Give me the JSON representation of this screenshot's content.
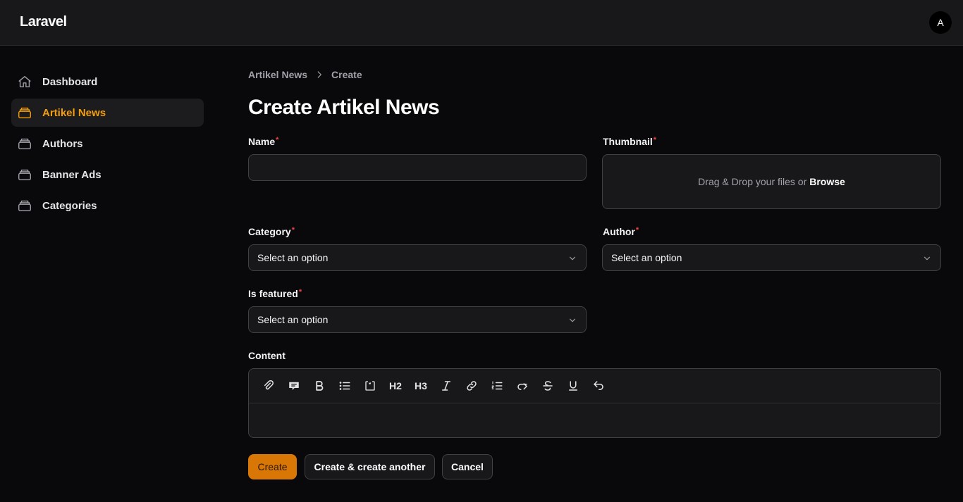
{
  "app": {
    "brand": "Laravel",
    "avatar_initial": "A"
  },
  "sidebar": {
    "items": [
      {
        "label": "Dashboard",
        "icon": "home-icon",
        "active": false
      },
      {
        "label": "Artikel News",
        "icon": "stack-icon",
        "active": true
      },
      {
        "label": "Authors",
        "icon": "stack-icon",
        "active": false
      },
      {
        "label": "Banner Ads",
        "icon": "stack-icon",
        "active": false
      },
      {
        "label": "Categories",
        "icon": "stack-icon",
        "active": false
      }
    ]
  },
  "breadcrumb": {
    "parent": "Artikel News",
    "current": "Create",
    "separator_icon": "chevron-right-icon"
  },
  "page": {
    "title": "Create Artikel News"
  },
  "form": {
    "name": {
      "label": "Name",
      "required_mark": "*",
      "value": ""
    },
    "thumbnail": {
      "label": "Thumbnail",
      "required_mark": "*",
      "drop_text": "Drag & Drop your files or",
      "browse_text": "Browse"
    },
    "category": {
      "label": "Category",
      "required_mark": "*",
      "value": "Select an option"
    },
    "author": {
      "label": "Author",
      "required_mark": "*",
      "value": "Select an option"
    },
    "is_featured": {
      "label": "Is featured",
      "required_mark": "*",
      "value": "Select an option"
    },
    "content": {
      "label": "Content",
      "toolbar": [
        "attach-files-icon",
        "blockquote-icon",
        "bold-icon",
        "bullet-list-icon",
        "code-block-icon",
        "h2-icon",
        "h3-icon",
        "italic-icon",
        "link-icon",
        "ordered-list-icon",
        "redo-icon",
        "strike-icon",
        "underline-icon",
        "undo-icon"
      ],
      "h2_text": "H2",
      "h3_text": "H3"
    }
  },
  "actions": {
    "create": "Create",
    "create_another": "Create & create another",
    "cancel": "Cancel"
  },
  "colors": {
    "accent": "#f59e0b",
    "primary_button": "#d97706",
    "required": "#ef4444"
  }
}
